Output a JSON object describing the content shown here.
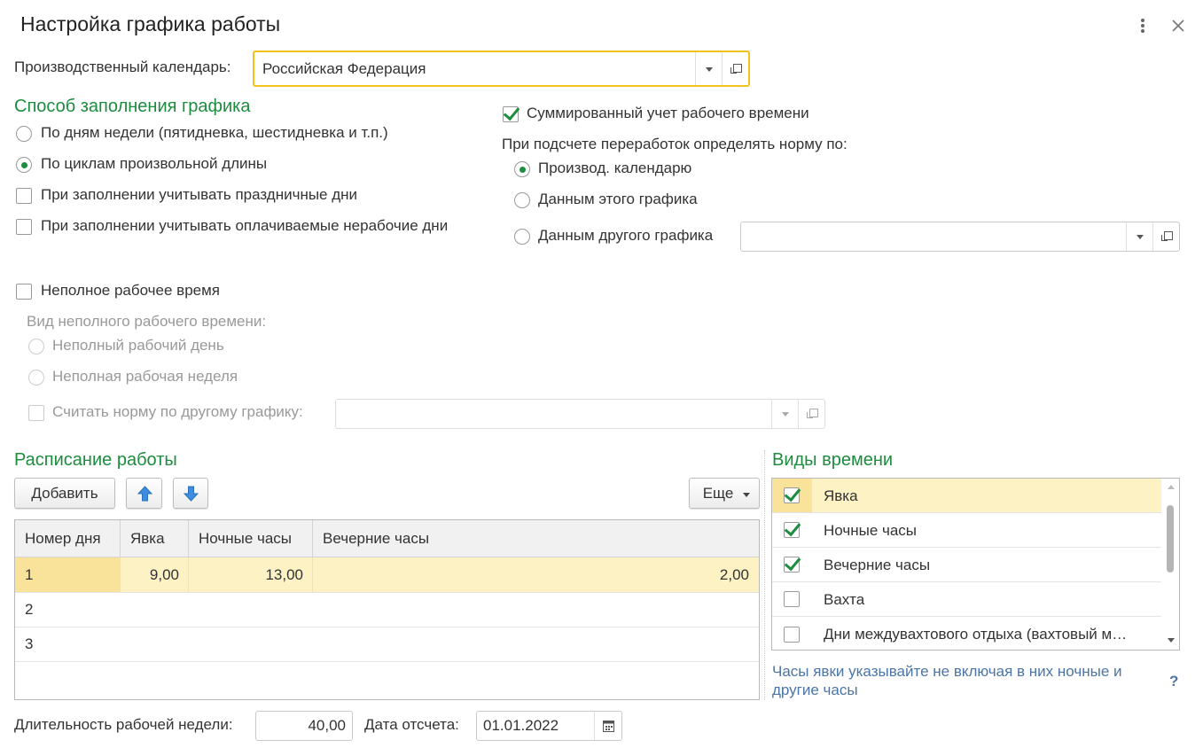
{
  "window": {
    "title": "Настройка графика работы",
    "more_icon": "more-vertical-icon",
    "close_icon": "close-icon"
  },
  "calendar": {
    "label": "Производственный календарь:",
    "value": "Российская Федерация"
  },
  "fill_method": {
    "heading": "Способ заполнения графика",
    "options": [
      {
        "label": "По дням недели (пятидневка, шестидневка и т.п.)",
        "selected": false
      },
      {
        "label": "По циклам произвольной длины",
        "selected": true
      }
    ],
    "holidays_label": "При заполнении учитывать праздничные дни",
    "paid_nonworking_label": "При заполнении учитывать оплачиваемые нерабочие дни"
  },
  "summary": {
    "summed_label": "Суммированный учет рабочего времени",
    "summed_checked": true,
    "overtime_label": "При подсчете переработок определять норму по:",
    "options": [
      {
        "label": "Производ. календарю",
        "selected": true
      },
      {
        "label": "Данным этого графика",
        "selected": false
      },
      {
        "label": "Данным другого графика",
        "selected": false
      }
    ],
    "other_schedule_value": ""
  },
  "part_time": {
    "label": "Неполное рабочее время",
    "kind_label": "Вид неполного рабочего времени:",
    "options": [
      {
        "label": "Неполный рабочий день"
      },
      {
        "label": "Неполная рабочая неделя"
      }
    ],
    "norm_label": "Считать норму по другому графику:",
    "norm_value": ""
  },
  "schedule": {
    "heading": "Расписание работы",
    "add_label": "Добавить",
    "more_label": "Еще",
    "up_icon": "arrow-up-icon",
    "down_icon": "arrow-down-icon",
    "columns": [
      "Номер дня",
      "Явка",
      "Ночные часы",
      "Вечерние часы"
    ],
    "rows": [
      [
        "1",
        "9,00",
        "13,00",
        "2,00"
      ],
      [
        "2",
        "",
        "",
        ""
      ],
      [
        "3",
        "",
        "",
        ""
      ]
    ]
  },
  "time_types": {
    "heading": "Виды времени",
    "items": [
      {
        "label": "Явка",
        "checked": true
      },
      {
        "label": "Ночные часы",
        "checked": true
      },
      {
        "label": "Вечерние часы",
        "checked": true
      },
      {
        "label": "Вахта",
        "checked": false
      },
      {
        "label": "Дни междувахтового отдыха (вахтовый м…",
        "checked": false
      }
    ],
    "hint": "Часы явки указывайте не включая в них ночные и другие часы",
    "help": "?"
  },
  "footer": {
    "week_label": "Длительность рабочей недели:",
    "week_value": "40,00",
    "date_label": "Дата отсчета:",
    "date_value": "01.01.2022",
    "calendar_icon": "calendar-icon"
  },
  "colors": {
    "accent_green": "#1c8c3e",
    "focus_yellow": "#f1c21b",
    "selected_row": "#fdf2c4",
    "selected_cell": "#f9e39b",
    "hint_blue": "#4b74a8"
  }
}
